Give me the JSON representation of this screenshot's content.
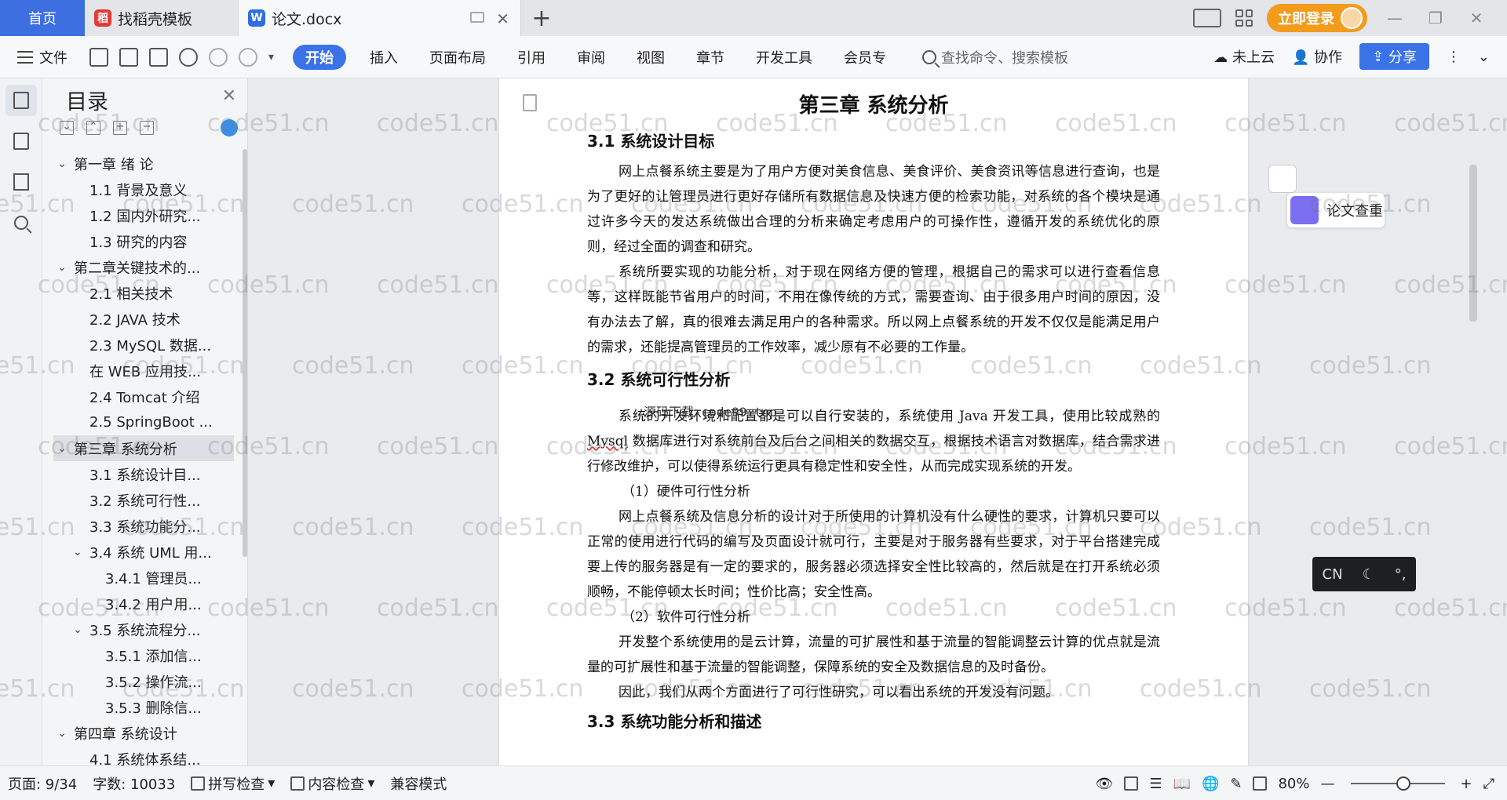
{
  "tabs": {
    "home": "首页",
    "template_tab": "找稻壳模板",
    "doc_tab": "论文.docx",
    "add": "+"
  },
  "titlebar": {
    "login": "立即登录"
  },
  "ribbon": {
    "file_menu": "文件",
    "tabs": [
      "开始",
      "插入",
      "页面布局",
      "引用",
      "审阅",
      "视图",
      "章节",
      "开发工具",
      "会员专"
    ],
    "search_placeholder": "查找命令、搜索模板",
    "cloud": "未上云",
    "collab": "协作",
    "share": "分享"
  },
  "toc": {
    "title": "目录",
    "items": [
      {
        "label": "第一章 绪 论",
        "level": 0,
        "caret": "⌄"
      },
      {
        "label": "1.1 背景及意义",
        "level": 1,
        "caret": ""
      },
      {
        "label": "1.2 国内外研究...",
        "level": 1,
        "caret": ""
      },
      {
        "label": "1.3 研究的内容",
        "level": 1,
        "caret": ""
      },
      {
        "label": "第二章关键技术的...",
        "level": 0,
        "caret": "⌄"
      },
      {
        "label": "2.1 相关技术",
        "level": 1,
        "caret": ""
      },
      {
        "label": "2.2 JAVA 技术",
        "level": 1,
        "caret": ""
      },
      {
        "label": "2.3 MySQL 数据...",
        "level": 1,
        "caret": ""
      },
      {
        "label": "在 WEB 应用技...",
        "level": 1,
        "caret": ""
      },
      {
        "label": "2.4 Tomcat 介绍",
        "level": 1,
        "caret": ""
      },
      {
        "label": "2.5 SpringBoot ...",
        "level": 1,
        "caret": ""
      },
      {
        "label": "第三章 系统分析",
        "level": 0,
        "caret": "⌄",
        "selected": true
      },
      {
        "label": "3.1 系统设计目...",
        "level": 1,
        "caret": ""
      },
      {
        "label": "3.2 系统可行性...",
        "level": 1,
        "caret": ""
      },
      {
        "label": "3.3 系统功能分...",
        "level": 1,
        "caret": ""
      },
      {
        "label": "3.4 系统 UML 用...",
        "level": 1,
        "caret": "⌄"
      },
      {
        "label": "3.4.1 管理员...",
        "level": 2,
        "caret": ""
      },
      {
        "label": "3.4.2 用户用...",
        "level": 2,
        "caret": ""
      },
      {
        "label": "3.5 系统流程分...",
        "level": 1,
        "caret": "⌄"
      },
      {
        "label": "3.5.1 添加信...",
        "level": 2,
        "caret": ""
      },
      {
        "label": "3.5.2 操作流...",
        "level": 2,
        "caret": ""
      },
      {
        "label": "3.5.3 删除信...",
        "level": 2,
        "caret": ""
      },
      {
        "label": "第四章 系统设计",
        "level": 0,
        "caret": "⌄"
      },
      {
        "label": "4.1 系统体系结...",
        "level": 1,
        "caret": ""
      }
    ]
  },
  "doc": {
    "chapter": "第三章  系统分析",
    "s31": "3.1  系统设计目标",
    "p1": "网上点餐系统主要是为了用户方便对美食信息、美食评价、美食资讯等信息进行查询，也是为了更好的让管理员进行更好存储所有数据信息及快速方便的检索功能，对系统的各个模块是通过许多今天的发达系统做出合理的分析来确定考虑用户的可操作性，遵循开发的系统优化的原则，经过全面的调查和研究。",
    "p2": "系统所要实现的功能分析，对于现在网络方便的管理，根据自己的需求可以进行查看信息等，这样既能节省用户的时间，不用在像传统的方式，需要查询、由于很多用户时间的原因，没有办法去了解，真的很难去满足用户的各种需求。所以网上点餐系统的开发不仅仅是能满足用户的需求，还能提高管理员的工作效率，减少原有不必要的工作量。",
    "s32": "3.2  系统可行性分析",
    "stamp": "源码下载-code99.top",
    "p3a": "系统的开发环境和配置都是可以自行安装的，系统使用 Java 开发工具，使用比较成熟的 ",
    "p3b": "Mysql",
    "p3c": " 数据库进行对系统前台及后台之间相关的数据交互，根据技术语言对数据库，结合需求进行修改维护，可以使得系统运行更具有稳定性和安全性，从而完成实现系统的开发。",
    "h1": "（1）硬件可行性分析",
    "p4": "网上点餐系统及信息分析的设计对于所使用的计算机没有什么硬性的要求，计算机只要可以正常的使用进行代码的编写及页面设计就可行，主要是对于服务器有些要求，对于平台搭建完成要上传的服务器是有一定的要求的，服务器必须选择安全性比较高的，然后就是在打开系统必须顺畅，不能停顿太长时间；性价比高；安全性高。",
    "h2": "（2）软件可行性分析",
    "p5": "开发整个系统使用的是云计算，流量的可扩展性和基于流量的智能调整云计算的优点就是流量的可扩展性和基于流量的智能调整，保障系统的安全及数据信息的及时备份。",
    "p6": "因此，我们从两个方面进行了可行性研究，可以看出系统的开发没有问题。",
    "s33": "3.3  系统功能分析和描述"
  },
  "watermark": "code51.cn",
  "floating": {
    "check": "论文查重",
    "ime_lang": "CN",
    "ime_moon": "☾",
    "ime_punct": "°,"
  },
  "status": {
    "page": "页面: 9/34",
    "words": "字数: 10033",
    "spell": "拼写检查",
    "content_check": "内容检查",
    "compat": "兼容模式",
    "zoom": "80%"
  },
  "colors": {
    "accent": "#3a73e8",
    "home_tab": "#3d6fe0",
    "login": "#f29b1c"
  }
}
